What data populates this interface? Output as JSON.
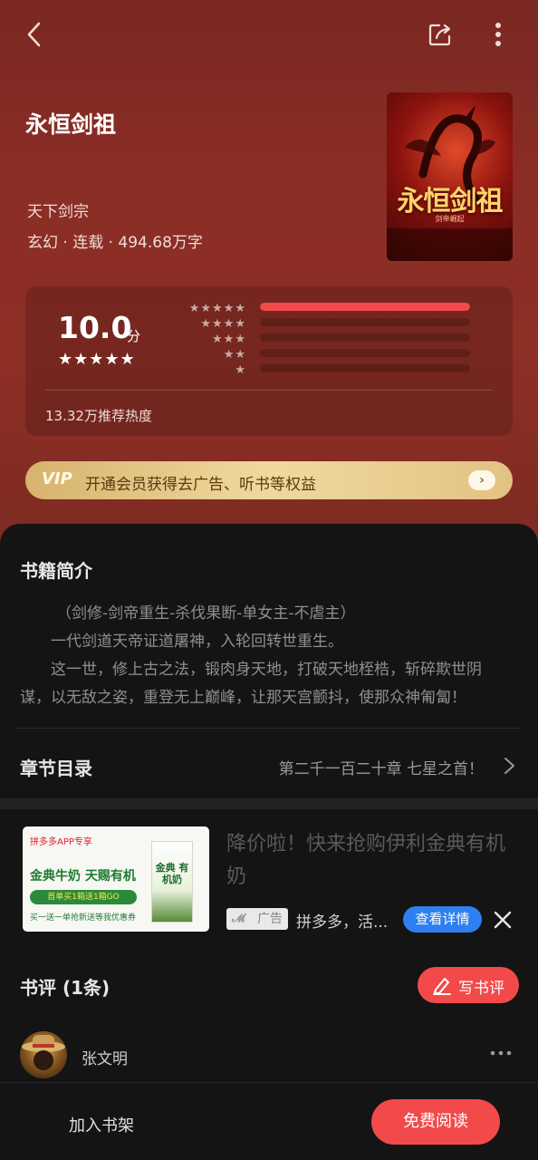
{
  "colors": {
    "accent": "#f24a4a",
    "hero_bg": "#8a2d25",
    "sheet_bg": "#141414",
    "ad_button": "#2f7ff0",
    "vip_gold": "#e2c283"
  },
  "topbar": {
    "back_icon": "chevron-left-icon",
    "share_icon": "share-icon",
    "more_icon": "more-vertical-icon"
  },
  "book": {
    "title": "永恒剑祖",
    "author": "天下剑宗",
    "meta": "玄幻 · 连载 · 494.68万字",
    "cover_title": "永恒剑祖",
    "cover_sub": "剑帝崛起"
  },
  "rating": {
    "score": "10.0",
    "unit": "分",
    "stars": "★★★★★",
    "star_rows": [
      "★★★★★",
      "★★★★",
      "★★★",
      "★★",
      "★"
    ],
    "distribution": [
      1.0,
      0,
      0,
      0,
      0
    ],
    "heat": "13.32万推荐热度"
  },
  "vip": {
    "badge": "VIP",
    "text": "开通会员获得去广告、听书等权益",
    "arrow": "›"
  },
  "intro": {
    "title": "书籍简介",
    "lines": [
      "（剑修-剑帝重生-杀伐果断-单女主-不虐主）",
      "一代剑道天帝证道屠神，入轮回转世重生。",
      "这一世，修上古之法，锻肉身天地，打破天地桎梏，斩碎欺世阴",
      "谋，以无敌之姿，重登无上巅峰，让那天宫颤抖，使那众神匍匐！"
    ]
  },
  "toc": {
    "title": "章节目录",
    "latest": "第二千一百二十章 七星之首！"
  },
  "ad": {
    "image_tag": "拼多多APP专享",
    "image_headline": "金典牛奶 天赐有机",
    "image_promo": "首单买1箱送1箱GO",
    "image_foot": "买一送一单抢新送等我优惠券",
    "image_carton": "金典 有机奶",
    "title": "降价啦！快来抢购伊利金典有机奶",
    "badge": "广告",
    "source": "拼多多，活...",
    "detail": "查看详情"
  },
  "reviews": {
    "title": "书评 (1条)",
    "write_label": "写书评",
    "items": [
      {
        "user": "张文明"
      }
    ]
  },
  "bottom": {
    "add_shelf": "加入书架",
    "read_free": "免费阅读"
  }
}
